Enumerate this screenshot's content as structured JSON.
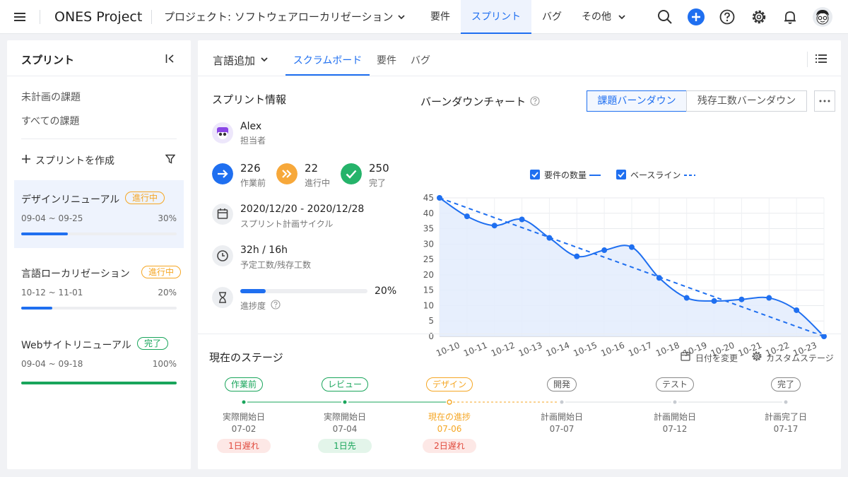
{
  "topbar": {
    "app_title": "ONES Project",
    "project_title": "プロジェクト: ソフトウェアローカリゼーション",
    "nav": [
      "要件",
      "スプリント",
      "バグ",
      "その他"
    ]
  },
  "sidebar": {
    "title": "スプリント",
    "links": [
      "未計画の課題",
      "すべての課題"
    ],
    "create_label": "スプリントを作成",
    "sprints": [
      {
        "name": "デザインリニューアル",
        "status": "進行中",
        "range": "09-04 ~ 09-25",
        "percent": "30%",
        "progress": 0.3,
        "color": "#1f6ff0"
      },
      {
        "name": "言語ローカリゼーション",
        "status": "進行中",
        "range": "10-12 ~ 11-01",
        "percent": "20%",
        "progress": 0.2,
        "color": "#1f6ff0"
      },
      {
        "name": "Webサイトリニューアル",
        "status": "完了",
        "range": "09-04 ~ 09-18",
        "percent": "100%",
        "progress": 1.0,
        "color": "#19a55b"
      }
    ]
  },
  "main": {
    "dropdown_label": "言語追加",
    "tabs": [
      "スクラムボード",
      "要件",
      "バグ"
    ],
    "info": {
      "title": "スプリント情報",
      "owner_name": "Alex",
      "owner_role": "担当者",
      "stats": [
        {
          "value": "226",
          "label": "作業前",
          "color": "#1f6ff0"
        },
        {
          "value": "22",
          "label": "進行中",
          "color": "#f7a83a"
        },
        {
          "value": "250",
          "label": "完了",
          "color": "#25b36a"
        }
      ],
      "date_range": "2020/12/20 - 2020/12/28",
      "date_label": "スプリント計画サイクル",
      "hours": "32h / 16h",
      "hours_label": "予定工数/残存工数",
      "progress_value": "20%",
      "progress": 0.2,
      "progress_label": "進捗度"
    },
    "chart_header": {
      "title": "バーンダウンチャート",
      "btn_issue": "課題バーンダウン",
      "btn_work": "残存工数バーンダウン"
    },
    "stages": {
      "title": "現在のステージ",
      "change_date": "日付を変更",
      "custom_stage": "カスタムステージ",
      "items": [
        {
          "name": "作業前",
          "label": "実際開始日",
          "date": "07-02",
          "badge": "1日遅れ",
          "kind": "done"
        },
        {
          "name": "レビュー",
          "label": "実際開始日",
          "date": "07-04",
          "badge": "1日先",
          "kind": "done"
        },
        {
          "name": "デザイン",
          "label": "現在の進捗",
          "date": "07-06",
          "badge": "2日遅れ",
          "kind": "current"
        },
        {
          "name": "開発",
          "label": "計画開始日",
          "date": "07-07",
          "badge": "",
          "kind": "todo"
        },
        {
          "name": "テスト",
          "label": "計画開始日",
          "date": "07-12",
          "badge": "",
          "kind": "todo"
        },
        {
          "name": "完了",
          "label": "計画完了日",
          "date": "07-17",
          "badge": "",
          "kind": "todo"
        }
      ]
    }
  },
  "chart_data": {
    "type": "line",
    "title": "バーンダウンチャート",
    "x": [
      "10-10",
      "10-11",
      "10-12",
      "10-13",
      "10-14",
      "10-15",
      "10-16",
      "10-17",
      "10-18",
      "10-19",
      "10-20",
      "10-21",
      "10-22",
      "10-23"
    ],
    "series": [
      {
        "name": "要件の数量",
        "values": [
          45,
          39,
          36,
          38,
          32,
          26,
          28,
          29,
          19,
          12.5,
          11.5,
          12,
          12.5,
          8.5,
          0
        ],
        "style": "solid"
      },
      {
        "name": "ベースライン",
        "values": [
          45,
          0
        ],
        "style": "dashed"
      }
    ],
    "y_ticks": [
      0,
      5,
      10,
      15,
      20,
      25,
      30,
      35,
      40,
      45
    ],
    "ylim": [
      0,
      45
    ],
    "grid": true,
    "legend": "top-center",
    "colors": {
      "line": "#1f6ff0",
      "area": "#e3ecfd"
    }
  }
}
